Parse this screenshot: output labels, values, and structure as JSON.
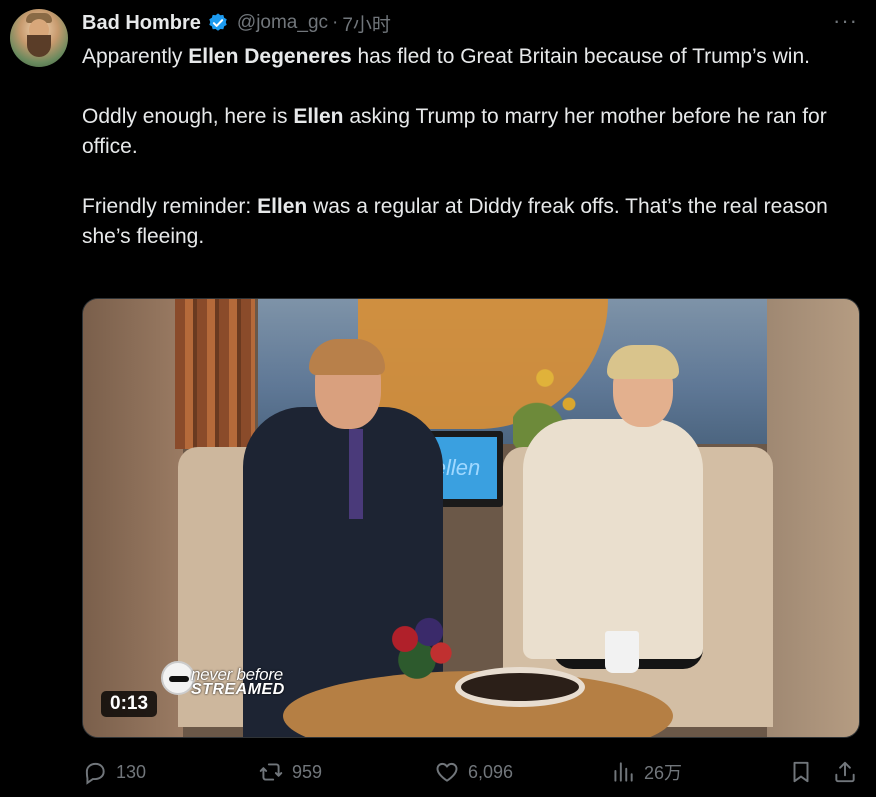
{
  "author": {
    "display_name": "Bad Hombre",
    "handle": "@joma_gc",
    "separator": "·",
    "time": "7小时"
  },
  "more_label": "···",
  "tweet": {
    "p1": {
      "t1": "Apparently ",
      "b1": "Ellen Degeneres",
      "t2": " has fled to Great Britain because of Trump’s win."
    },
    "p2": {
      "t1": "Oddly enough, here is ",
      "b1": "Ellen",
      "t2": " asking Trump to marry her mother before he ran for office."
    },
    "p3": {
      "t1": "Friendly reminder: ",
      "b1": "Ellen",
      "t2": " was a regular at Diddy freak offs. That’s the real reason she’s fleeing."
    }
  },
  "media": {
    "duration": "0:13",
    "overlay_line1": "never before",
    "overlay_line2": "STREAMED",
    "monitor_text": "ellen"
  },
  "actions": {
    "replies": "130",
    "reposts": "959",
    "likes": "6,096",
    "views": "26万"
  },
  "colors": {
    "background": "#000000",
    "text": "#e7e9ea",
    "muted": "#71767b",
    "verified": "#1d9bf0"
  }
}
